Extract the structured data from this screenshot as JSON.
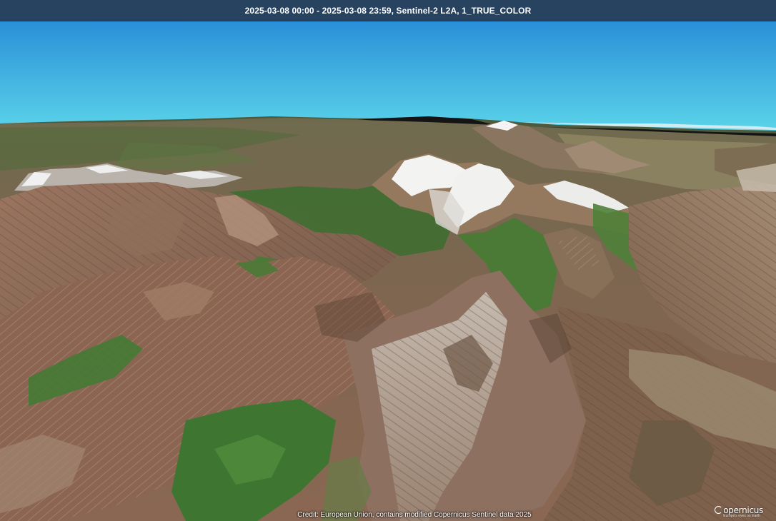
{
  "header": {
    "title": "2025-03-08 00:00 - 2025-03-08 23:59, Sentinel-2 L2A, 1_TRUE_COLOR"
  },
  "footer": {
    "credit": "Credit: European Union, contains modified Copernicus Sentinel data 2025"
  },
  "logo": {
    "name": "opernicus",
    "tagline": "Europe's eyes on Earth"
  },
  "colors": {
    "sky_top": "#2a8fd8",
    "sky_horizon": "#5cd6ea",
    "terrain_brown": "#8a6a55",
    "vegetation_green": "#3f7a32",
    "snow": "#f2f2f2",
    "title_bar": "#27435f"
  }
}
